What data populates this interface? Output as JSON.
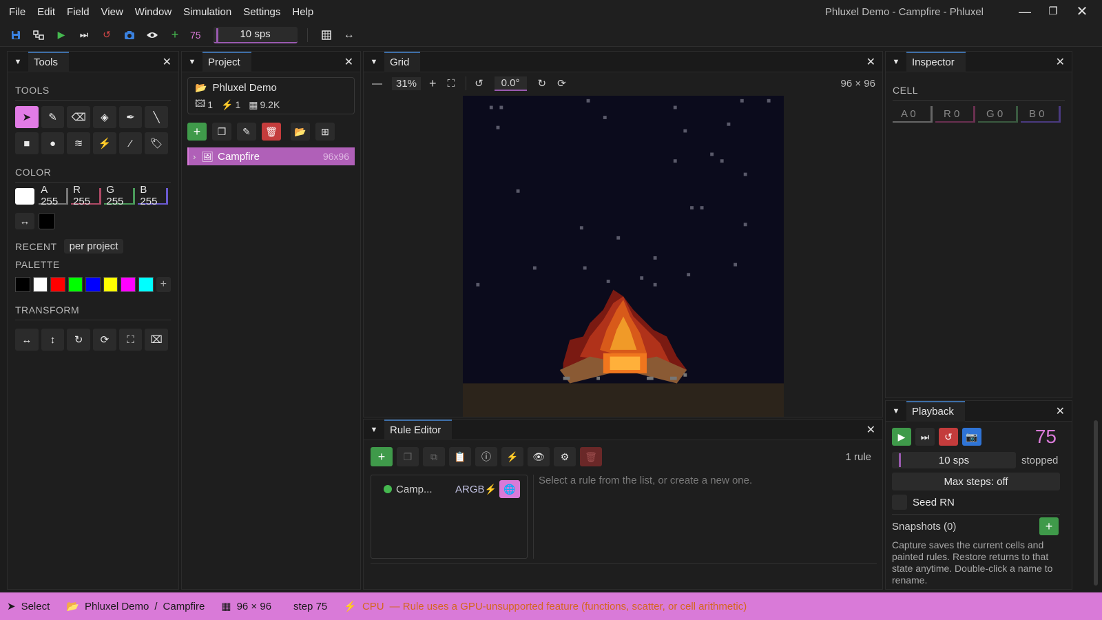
{
  "menu": [
    "File",
    "Edit",
    "Field",
    "View",
    "Window",
    "Simulation",
    "Settings",
    "Help"
  ],
  "window": {
    "title": "Phluxel Demo - Campfire - Phluxel"
  },
  "toolbar": {
    "step": "75",
    "speed": "10 sps"
  },
  "tools": {
    "tab": "Tools",
    "tools_label": "TOOLS",
    "color_label": "COLOR",
    "channels": [
      {
        "label": "A 255",
        "color": "#9a9a9a"
      },
      {
        "label": "R 255",
        "color": "#c24a66"
      },
      {
        "label": "G 255",
        "color": "#4a9a5a"
      },
      {
        "label": "B 255",
        "color": "#5a5ac8"
      }
    ],
    "recent_label": "RECENT",
    "recent_value": "per project",
    "palette_label": "PALETTE",
    "palette": [
      "#000000",
      "#ffffff",
      "#ff0000",
      "#00ff00",
      "#0000ff",
      "#ffff00",
      "#ff00ff",
      "#00ffff"
    ],
    "transform_label": "TRANSFORM"
  },
  "project": {
    "tab": "Project",
    "name": "Phluxel Demo",
    "images": "1",
    "rules": "1",
    "cells": "9.2K",
    "item_name": "Campfire",
    "item_size": "96x96"
  },
  "grid": {
    "tab": "Grid",
    "zoom": "31%",
    "rotation": "0.0°",
    "dims": "96 × 96"
  },
  "inspector": {
    "tab": "Inspector",
    "cell_label": "CELL",
    "channels": [
      {
        "label": "A  0",
        "color": "#9a9a9a"
      },
      {
        "label": "R  0",
        "color": "#c24a66"
      },
      {
        "label": "G  0",
        "color": "#4a9a5a"
      },
      {
        "label": "B  0",
        "color": "#5a5ac8"
      }
    ]
  },
  "rule_editor": {
    "tab": "Rule Editor",
    "count": "1 rule",
    "rule_name": "Camp...",
    "rule_tag": "ARGB",
    "placeholder": "Select a rule from the list, or create a new one."
  },
  "playback": {
    "tab": "Playback",
    "step": "75",
    "speed": "10 sps",
    "state": "stopped",
    "max_steps": "Max steps: off",
    "seed": "Seed RN",
    "snapshots": "Snapshots (0)",
    "help": "Capture saves the current cells and painted rules. Restore returns to that state anytime. Double-click a name to rename."
  },
  "status": {
    "tool": "Select",
    "project": "Phluxel Demo",
    "sep": "/",
    "field": "Campfire",
    "dims": "96 × 96",
    "step": "step 75",
    "backend": "CPU",
    "warning": "— Rule uses a GPU-unsupported feature (functions, scatter, or cell arithmetic)"
  }
}
